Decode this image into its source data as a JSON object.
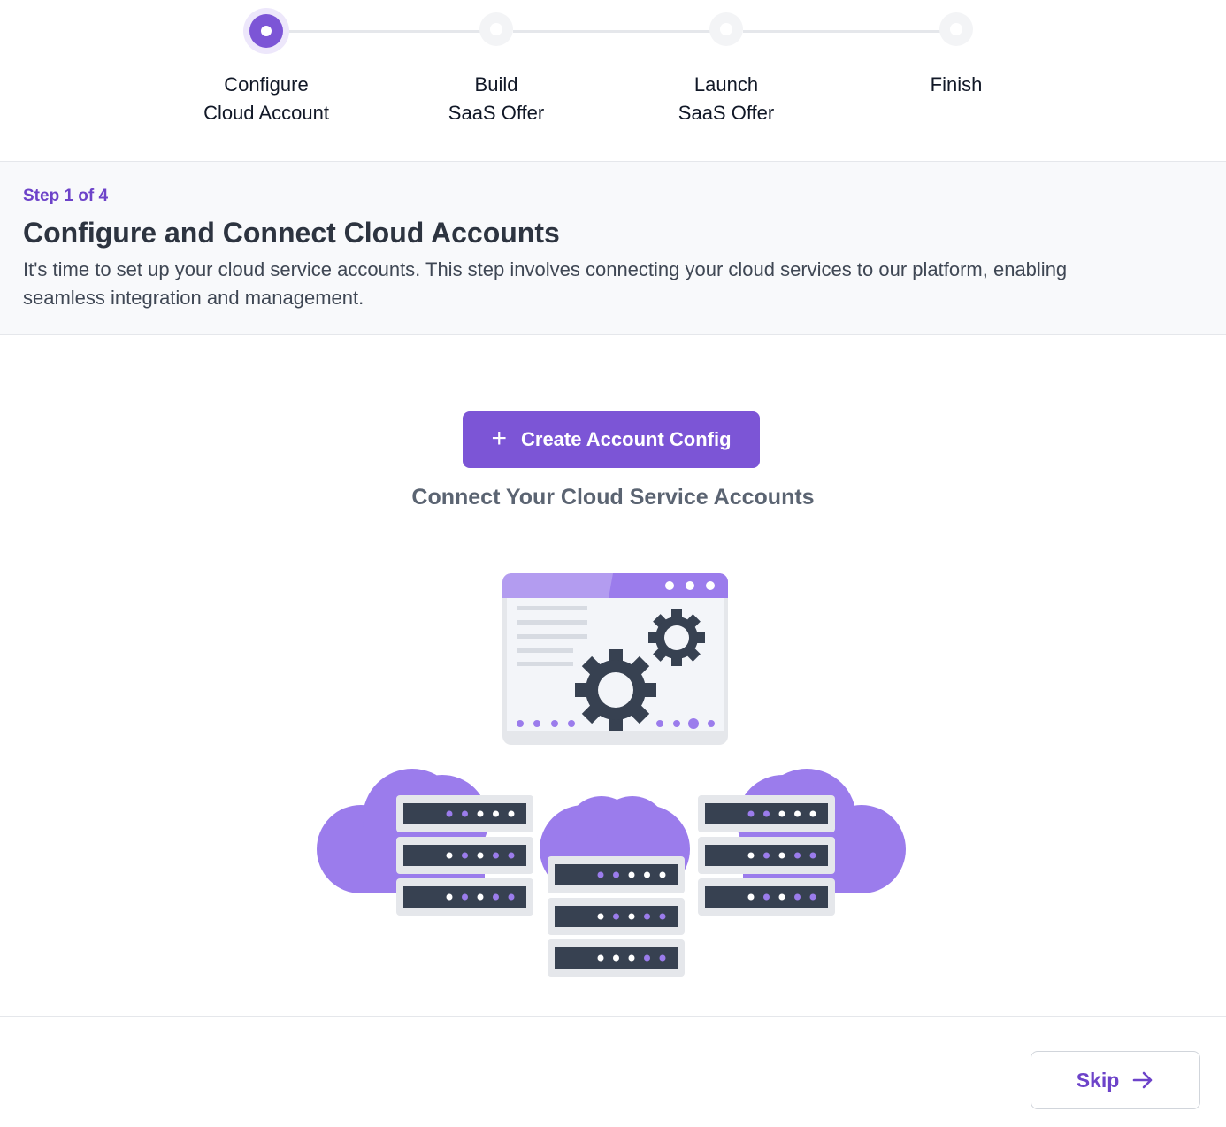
{
  "stepper": {
    "steps": [
      {
        "label": "Configure\nCloud Account",
        "state": "active"
      },
      {
        "label": "Build\nSaaS Offer",
        "state": "pending"
      },
      {
        "label": "Launch\nSaaS Offer",
        "state": "pending"
      },
      {
        "label": "Finish",
        "state": "pending"
      }
    ]
  },
  "info": {
    "step_count": "Step 1 of 4",
    "title": "Configure and Connect Cloud Accounts",
    "description": "It's time to set up your cloud service accounts. This step involves connecting your cloud services to our platform, enabling seamless integration and management."
  },
  "main": {
    "create_button_label": "Create Account Config",
    "subtitle": "Connect Your Cloud Service Accounts"
  },
  "footer": {
    "skip_label": "Skip"
  },
  "colors": {
    "accent": "#7c55d6",
    "accent_text": "#6d43c9",
    "cloud": "#9b7cec",
    "server": "#374151"
  }
}
